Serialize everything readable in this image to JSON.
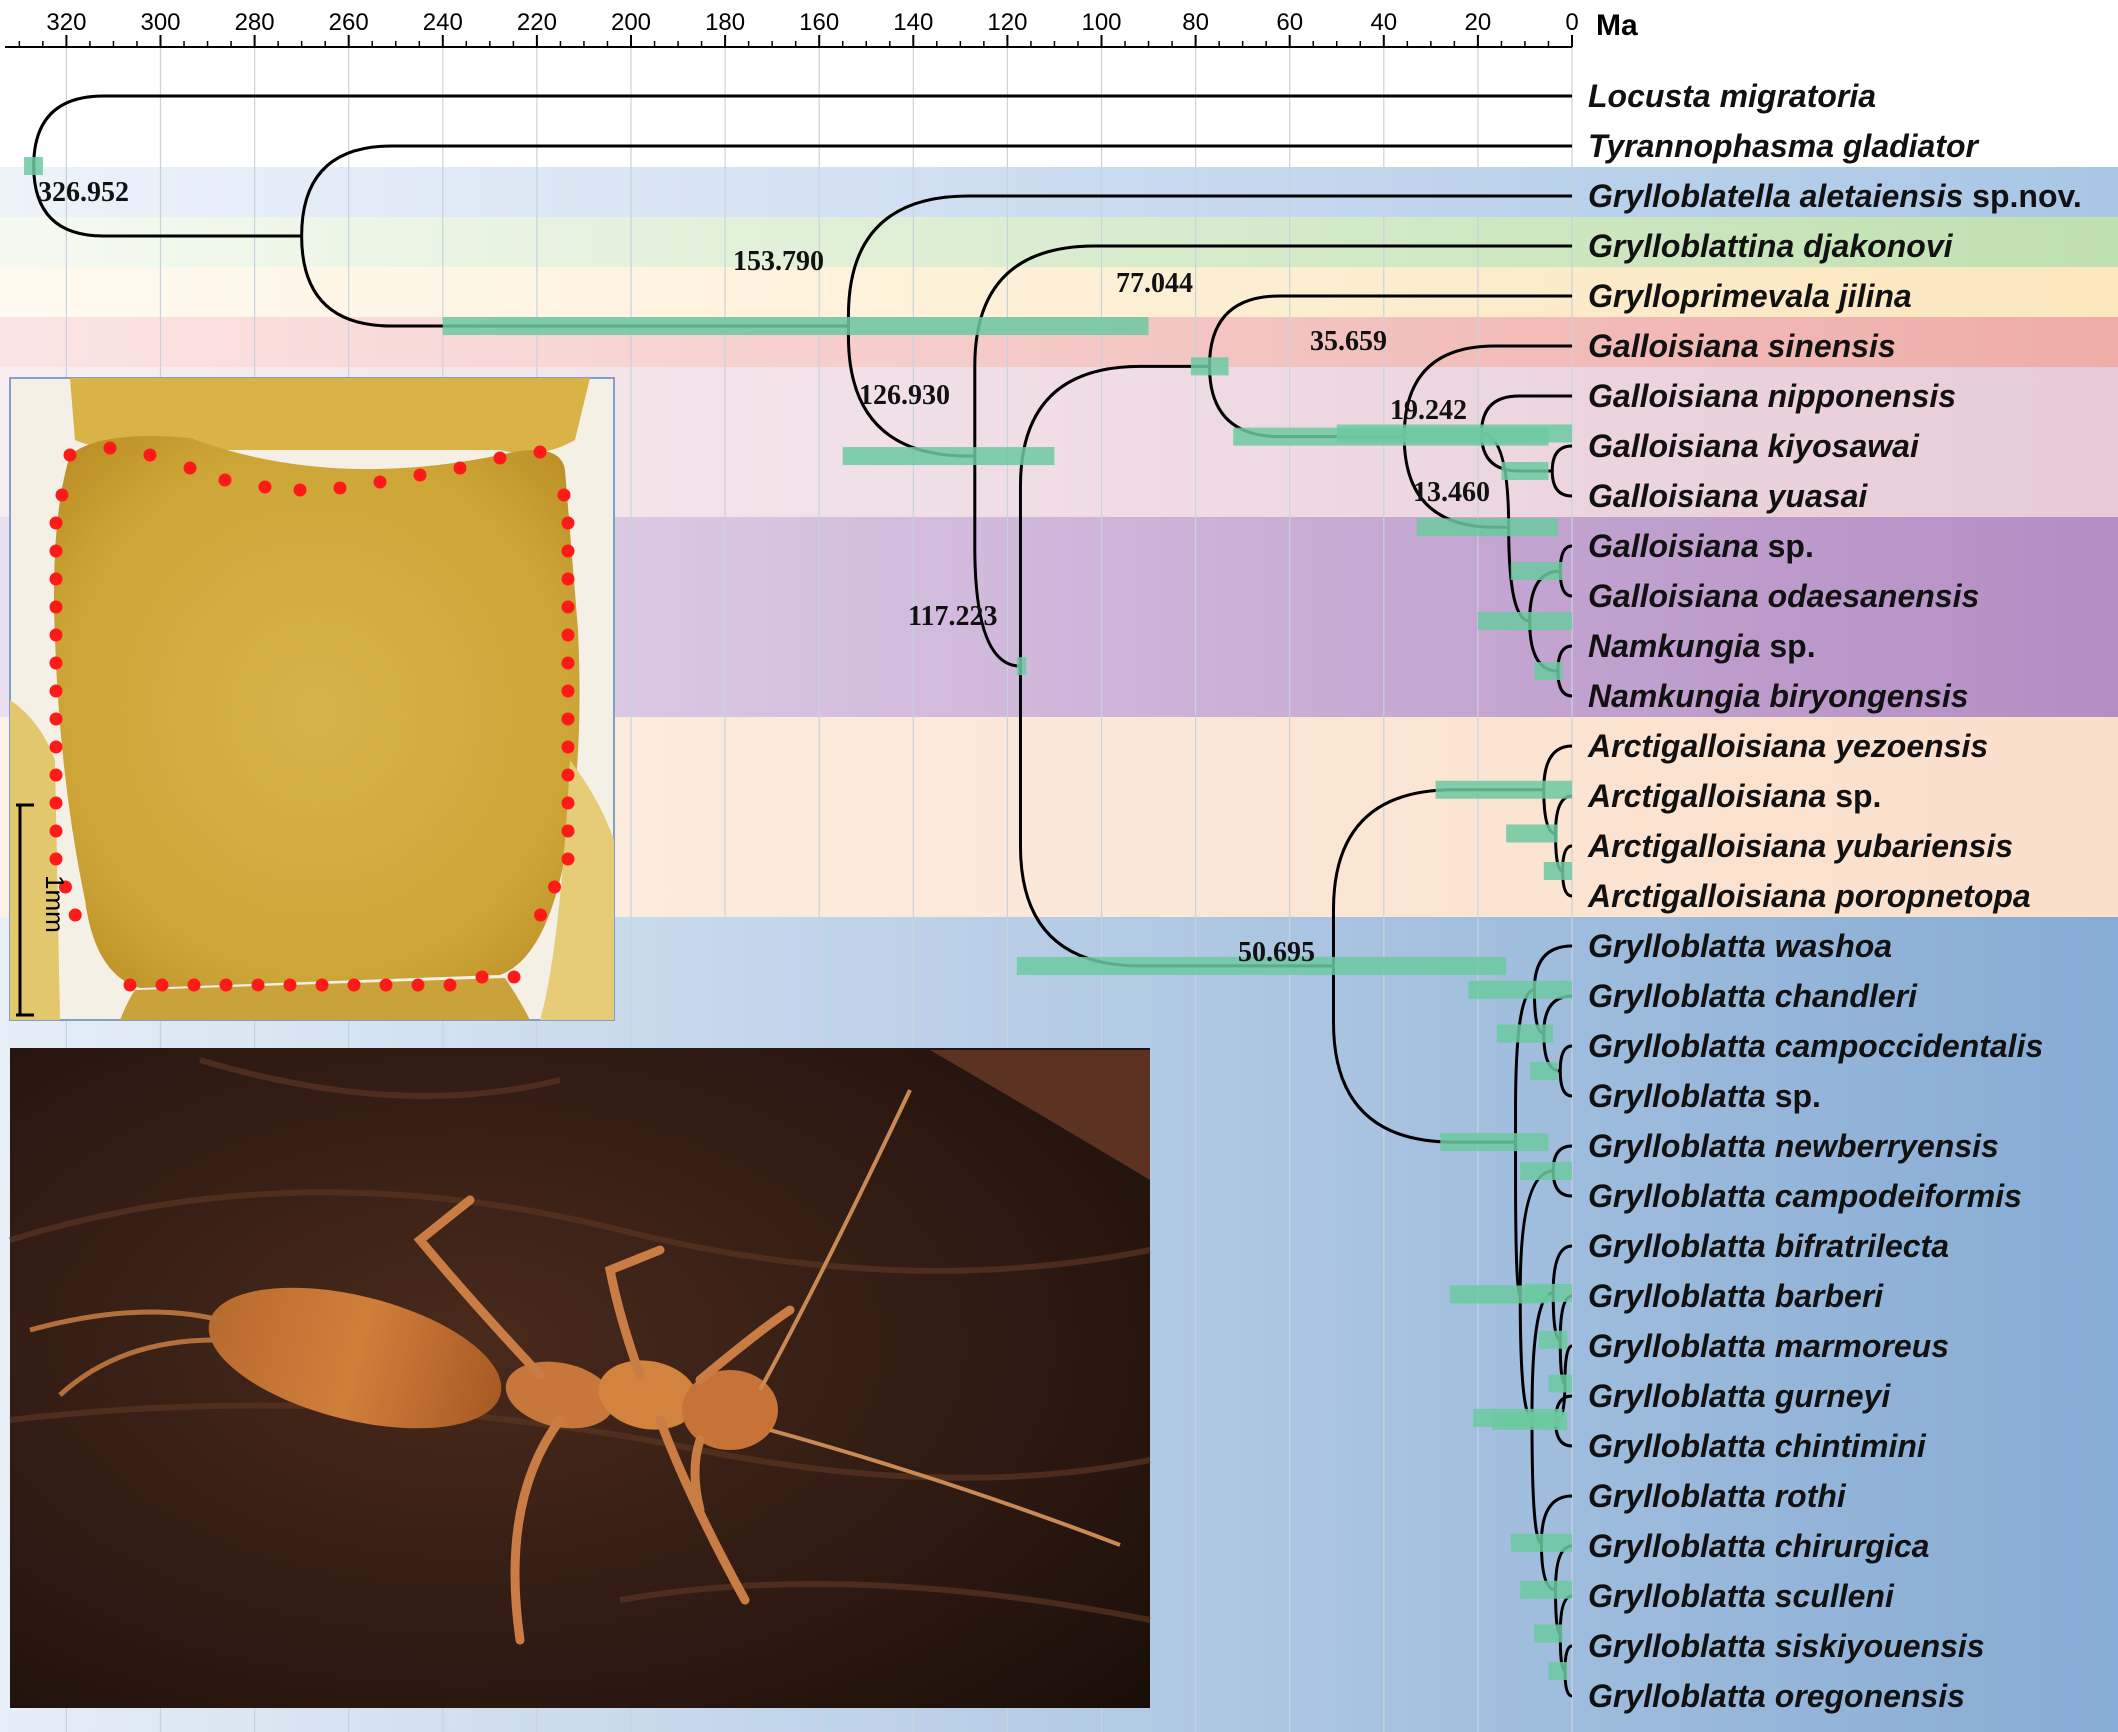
{
  "axis": {
    "unit": "Ma",
    "ticks": [
      320,
      300,
      280,
      260,
      240,
      220,
      200,
      180,
      160,
      140,
      120,
      100,
      80,
      60,
      40,
      20,
      0
    ],
    "range": [
      334,
      0
    ]
  },
  "taxa": [
    {
      "genus": "Locusta migratoria",
      "suffix": ""
    },
    {
      "genus": "Tyrannophasma gladiator",
      "suffix": ""
    },
    {
      "genus": "Grylloblatella aletaiensis",
      "suffix": " sp.nov."
    },
    {
      "genus": "Grylloblattina djakonovi",
      "suffix": ""
    },
    {
      "genus": "Grylloprimevala jilina",
      "suffix": ""
    },
    {
      "genus": "Galloisiana sinensis",
      "suffix": ""
    },
    {
      "genus": "Galloisiana nipponensis",
      "suffix": ""
    },
    {
      "genus": "Galloisiana kiyosawai",
      "suffix": ""
    },
    {
      "genus": "Galloisiana yuasai",
      "suffix": ""
    },
    {
      "genus": "Galloisiana",
      "suffix": " sp."
    },
    {
      "genus": "Galloisiana odaesanensis",
      "suffix": ""
    },
    {
      "genus": "Namkungia",
      "suffix": " sp."
    },
    {
      "genus": "Namkungia biryongensis",
      "suffix": ""
    },
    {
      "genus": "Arctigalloisiana yezoensis",
      "suffix": ""
    },
    {
      "genus": "Arctigalloisiana",
      "suffix": " sp."
    },
    {
      "genus": "Arctigalloisiana yubariensis",
      "suffix": ""
    },
    {
      "genus": "Arctigalloisiana poropnetopa",
      "suffix": ""
    },
    {
      "genus": "Grylloblatta washoa",
      "suffix": ""
    },
    {
      "genus": "Grylloblatta chandleri",
      "suffix": ""
    },
    {
      "genus": "Grylloblatta campoccidentalis",
      "suffix": ""
    },
    {
      "genus": "Grylloblatta",
      "suffix": " sp."
    },
    {
      "genus": "Grylloblatta newberryensis",
      "suffix": ""
    },
    {
      "genus": "Grylloblatta campodeiformis",
      "suffix": ""
    },
    {
      "genus": "Grylloblatta bifratrilecta",
      "suffix": ""
    },
    {
      "genus": "Grylloblatta barberi",
      "suffix": ""
    },
    {
      "genus": "Grylloblatta marmoreus",
      "suffix": ""
    },
    {
      "genus": "Grylloblatta gurneyi",
      "suffix": ""
    },
    {
      "genus": "Grylloblatta chintimini",
      "suffix": ""
    },
    {
      "genus": "Grylloblatta rothi",
      "suffix": ""
    },
    {
      "genus": "Grylloblatta chirurgica",
      "suffix": ""
    },
    {
      "genus": "Grylloblatta sculleni",
      "suffix": ""
    },
    {
      "genus": "Grylloblatta siskiyouensis",
      "suffix": ""
    },
    {
      "genus": "Grylloblatta oregonensis",
      "suffix": ""
    }
  ],
  "node_ages": {
    "root": "326.952",
    "n1": "153.790",
    "n2": "126.930",
    "n3": "117.223",
    "n4": "77.044",
    "n5": "35.659",
    "n6": "19.242",
    "n7": "13.460",
    "n8": "50.695"
  },
  "scale_bar": "1mm",
  "colors": {
    "band_blue": "#a9c6e6",
    "band_green": "#c4e2b6",
    "band_yellow": "#fbe7c2",
    "band_red": "#efb4b0",
    "band_pink": "#ead2dc",
    "band_purple": "#b792c6",
    "band_orange": "#fbe2cc",
    "band_steel": "#8fb3d8",
    "hpd_bar": "#6cc9a1",
    "scale_dot": "#ff1a1a"
  }
}
